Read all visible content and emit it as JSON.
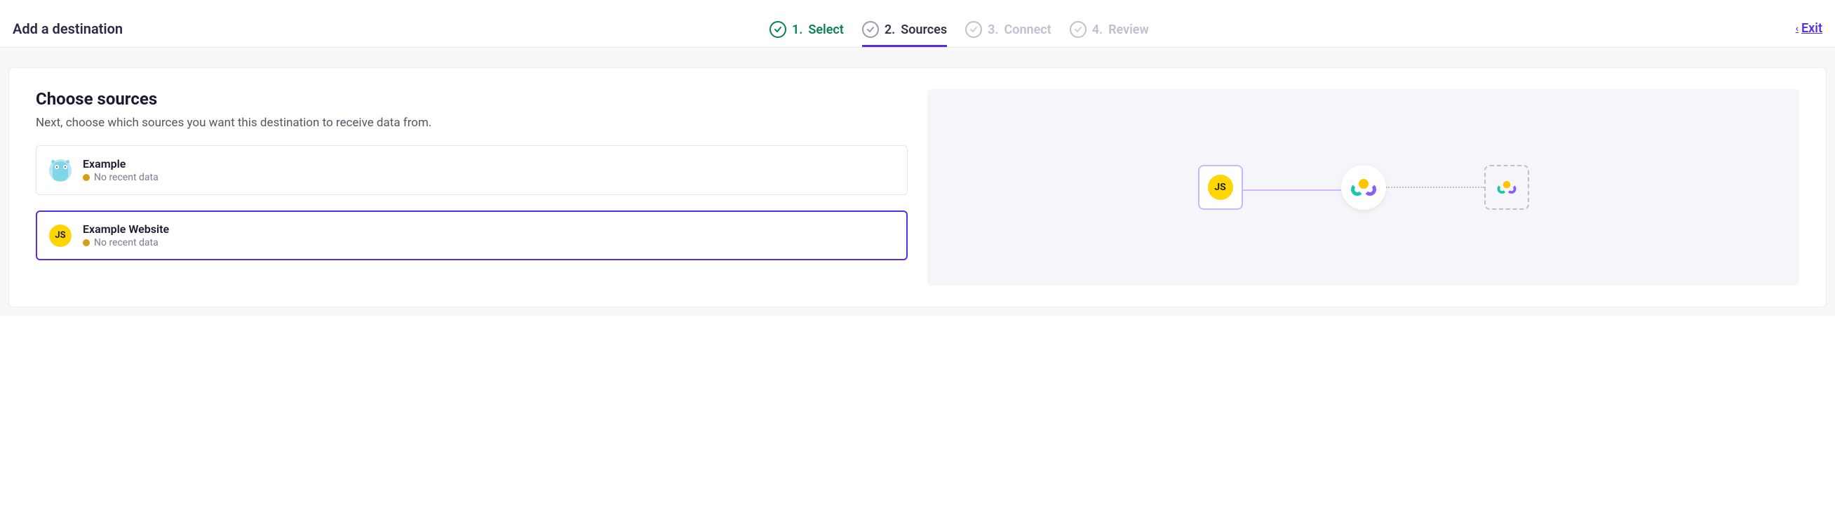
{
  "header": {
    "title": "Add a destination",
    "exit_label": "Exit"
  },
  "stepper": {
    "steps": [
      {
        "num": "1.",
        "label": "Select",
        "state": "complete"
      },
      {
        "num": "2.",
        "label": "Sources",
        "state": "active"
      },
      {
        "num": "3.",
        "label": "Connect",
        "state": "todo"
      },
      {
        "num": "4.",
        "label": "Review",
        "state": "todo"
      }
    ]
  },
  "choose": {
    "title": "Choose sources",
    "subtitle": "Next, choose which sources you want this destination to receive data from.",
    "sources": [
      {
        "name": "Example",
        "status": "No recent data",
        "icon": "go",
        "selected": false
      },
      {
        "name": "Example Website",
        "status": "No recent data",
        "icon": "js",
        "selected": true
      }
    ]
  },
  "diagram": {
    "source_badge": "JS"
  }
}
